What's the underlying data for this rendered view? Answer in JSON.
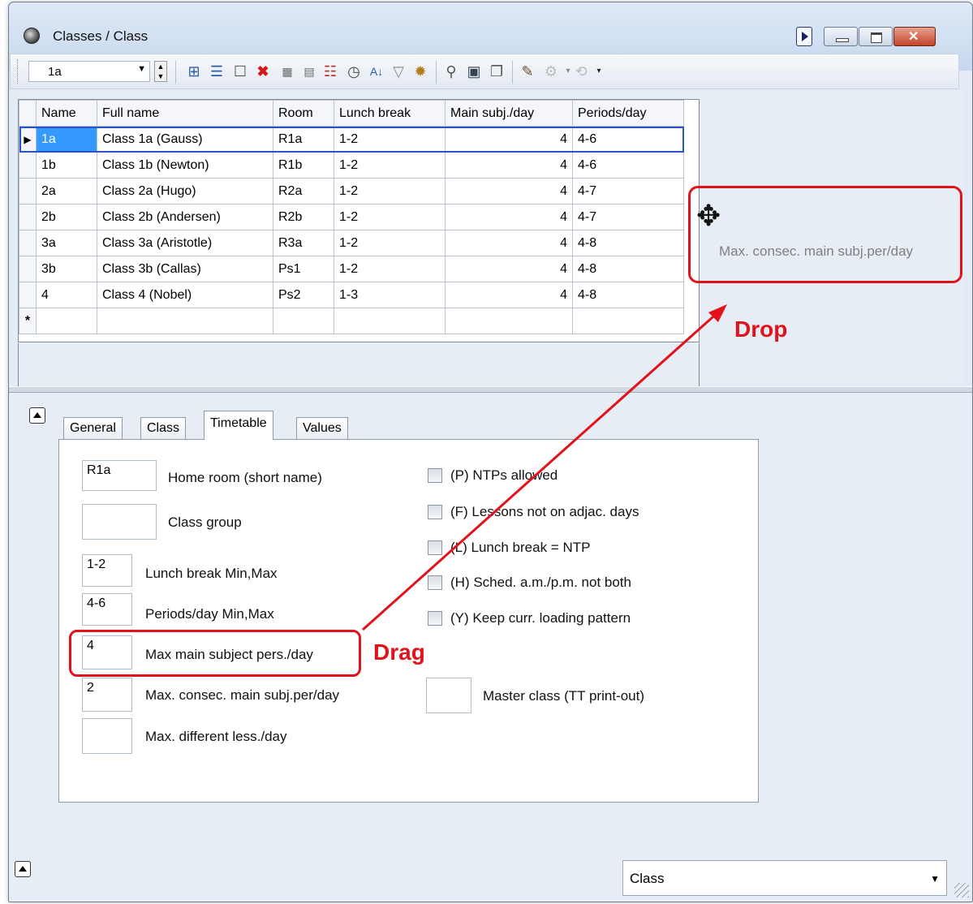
{
  "window": {
    "title": "Classes / Class"
  },
  "toolbar": {
    "selected_class": "1a",
    "icons": [
      "new-record-icon",
      "list-icon",
      "new-sheet-icon",
      "delete-icon",
      "grid-icon",
      "grid2-icon",
      "report-icon",
      "clock-icon",
      "sort-icon",
      "filter-icon",
      "settings-icon",
      "person-icon",
      "calendar-icon",
      "copy-icon",
      "paint-icon",
      "gear-disabled-icon",
      "dropdown-icon"
    ]
  },
  "grid": {
    "columns": [
      "Name",
      "Full name",
      "Room",
      "Lunch break",
      "Main subj./day",
      "Periods/day"
    ],
    "rows": [
      [
        "1a",
        "Class 1a (Gauss)",
        "R1a",
        "1-2",
        "4",
        "4-6"
      ],
      [
        "1b",
        "Class 1b (Newton)",
        "R1b",
        "1-2",
        "4",
        "4-6"
      ],
      [
        "2a",
        "Class 2a (Hugo)",
        "R2a",
        "1-2",
        "4",
        "4-7"
      ],
      [
        "2b",
        "Class 2b (Andersen)",
        "R2b",
        "1-2",
        "4",
        "4-7"
      ],
      [
        "3a",
        "Class 3a (Aristotle)",
        "R3a",
        "1-2",
        "4",
        "4-8"
      ],
      [
        "3b",
        "Class 3b (Callas)",
        "Ps1",
        "1-2",
        "4",
        "4-8"
      ],
      [
        "4",
        "Class 4 (Nobel)",
        "Ps2",
        "1-3",
        "4",
        "4-8"
      ]
    ],
    "new_row_marker": "*",
    "current_row_marker": "▶"
  },
  "drop_zone": {
    "text": "Max. consec. main subj.per/day",
    "label": "Drop"
  },
  "drag": {
    "label": "Drag"
  },
  "tabs": [
    "General",
    "Class",
    "Timetable",
    "Values"
  ],
  "form": {
    "home_room": {
      "value": "R1a",
      "label": "Home room (short name)"
    },
    "class_group": {
      "value": "",
      "label": "Class group"
    },
    "lunch_break": {
      "value": "1-2",
      "label": "Lunch break Min,Max"
    },
    "periods_day": {
      "value": "4-6",
      "label": "Periods/day Min,Max"
    },
    "max_main": {
      "value": "4",
      "label": "Max main subject pers./day"
    },
    "max_consec": {
      "value": "2",
      "label": "Max. consec. main subj.per/day"
    },
    "max_diff": {
      "value": "",
      "label": "Max. different less./day"
    },
    "checkboxes": [
      "(P) NTPs allowed",
      "(F) Lessons not on adjac. days",
      "(L) Lunch break = NTP",
      "(H) Sched. a.m./p.m. not both",
      "(Y) Keep curr. loading pattern"
    ],
    "master_class": {
      "value": "",
      "label": "Master class (TT print-out)"
    }
  },
  "status": {
    "view_select": "Class"
  },
  "colors": {
    "annotation": "#e2121c",
    "selection": "#3399ff"
  }
}
